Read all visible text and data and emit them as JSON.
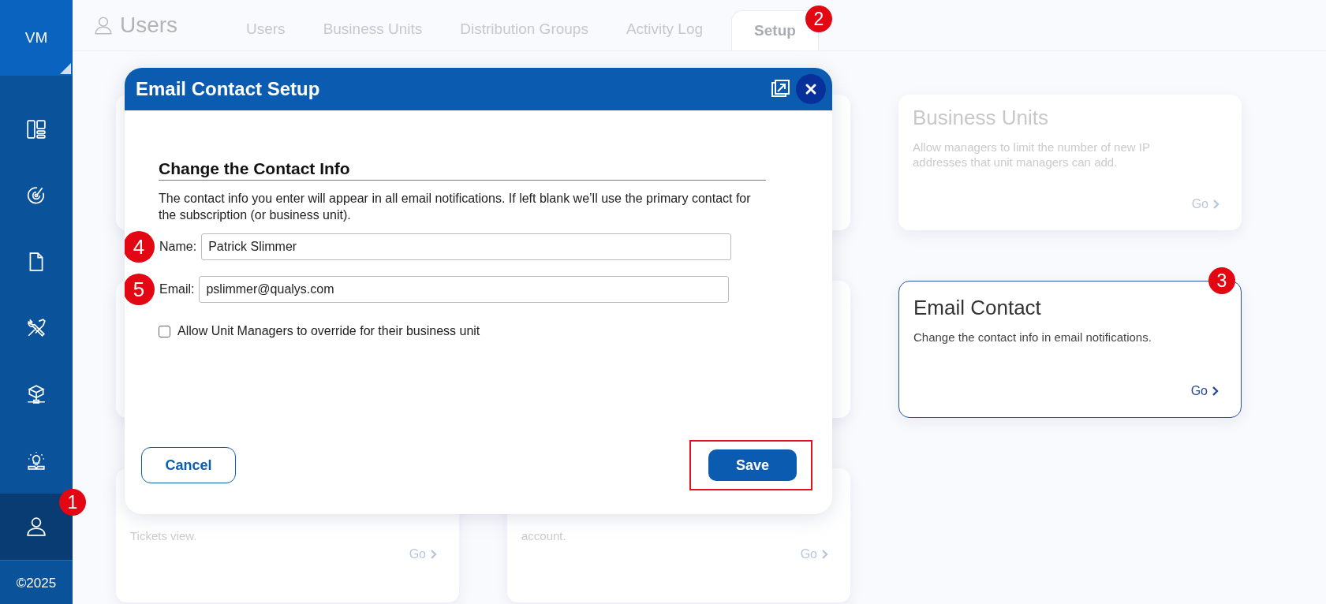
{
  "sidebar": {
    "logo": "VM",
    "items": [
      {
        "selected": false
      },
      {
        "selected": false
      },
      {
        "selected": false
      },
      {
        "selected": false
      },
      {
        "selected": false
      },
      {
        "selected": false
      },
      {
        "selected": true,
        "callout": "1"
      }
    ],
    "footer": "©2025"
  },
  "header": {
    "title": "Users",
    "tabs": [
      {
        "label": "Users",
        "selected": false
      },
      {
        "label": "Business Units",
        "selected": false
      },
      {
        "label": "Distribution Groups",
        "selected": false
      },
      {
        "label": "Activity Log",
        "selected": false
      },
      {
        "label": "Setup",
        "selected": true,
        "callout": "2"
      }
    ]
  },
  "cards": [
    {
      "kind": "hidden"
    },
    {
      "kind": "hidden"
    },
    {
      "kind": "setting",
      "title": "Business Units",
      "description": "Allow managers to limit the number of new IP addresses that unit managers can add.",
      "link": "Go",
      "selected": false
    },
    {
      "kind": "hidden"
    },
    {
      "kind": "hidden"
    },
    {
      "kind": "setting",
      "title": "Email Contact",
      "description": "Change the contact info in email notifications.",
      "link": "Go",
      "selected": true,
      "callout": "3"
    },
    {
      "kind": "partial",
      "description": "Tickets view.",
      "link": "Go"
    },
    {
      "kind": "partial",
      "description": "account.",
      "link": "Go"
    }
  ],
  "modal": {
    "title": "Email Contact Setup",
    "heading": "Change the Contact Info",
    "intro": "The contact info you enter will appear in all email notifications. If left blank we’ll use the primary contact for the subscription (or business unit).",
    "fields": [
      {
        "label": "Name:",
        "value": "Patrick Slimmer",
        "callout": "4"
      },
      {
        "label": "Email:",
        "value": "pslimmer@qualys.com",
        "callout": "5"
      }
    ],
    "checkbox": {
      "label": "Allow Unit Managers to override for their business unit",
      "checked": false
    },
    "cancel": {
      "label": "Cancel"
    },
    "save": {
      "label": "Save",
      "highlighted": true
    }
  }
}
